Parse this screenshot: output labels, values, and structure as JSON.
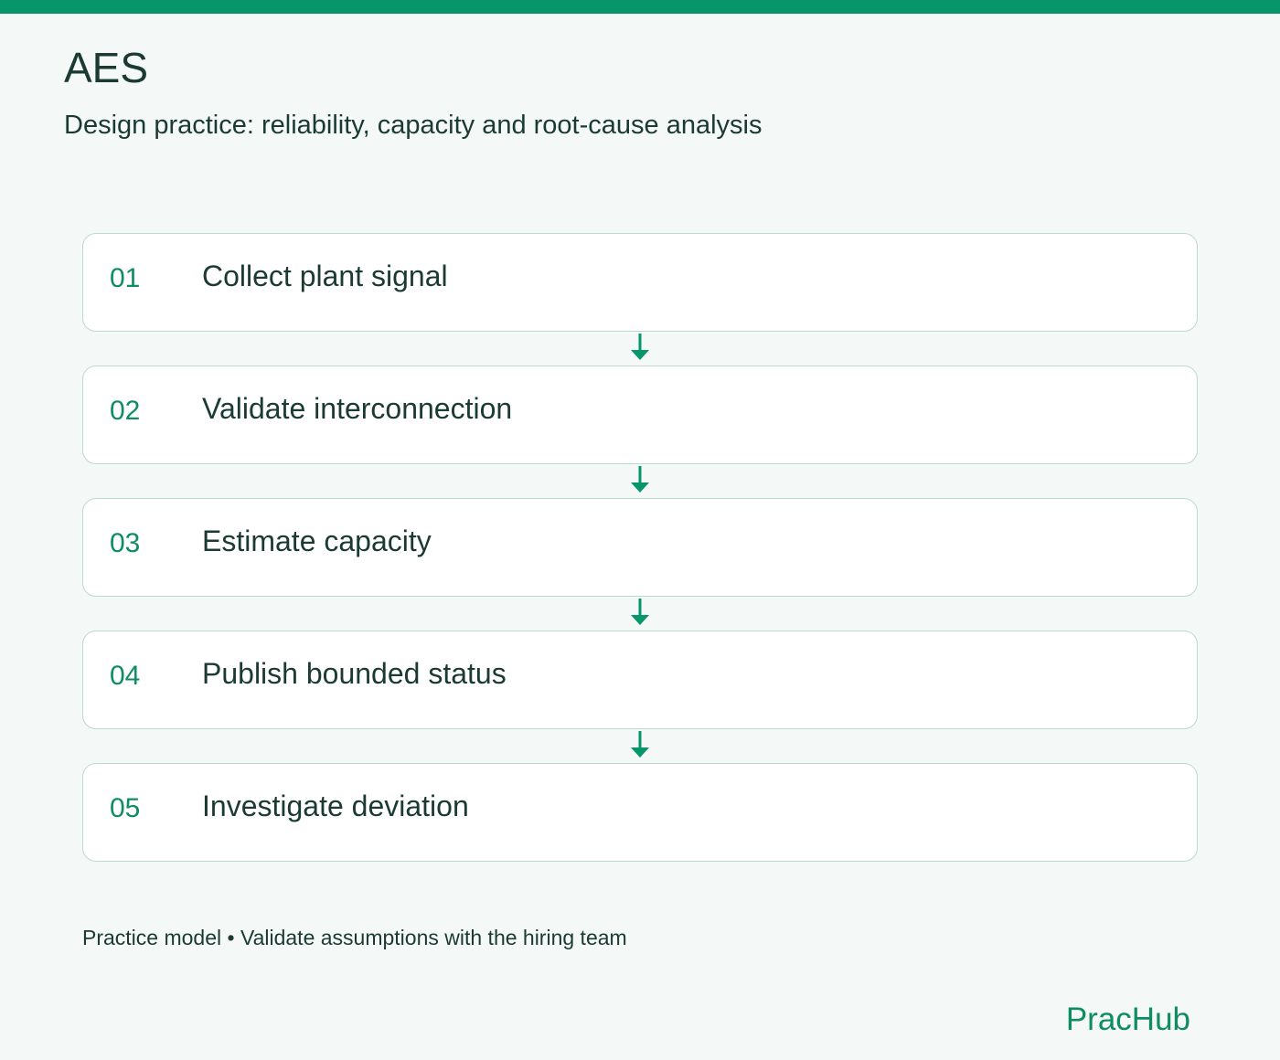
{
  "header": {
    "title": "AES",
    "subtitle": "Design practice: reliability, capacity and root-cause analysis"
  },
  "steps": [
    {
      "number": "01",
      "label": "Collect plant signal"
    },
    {
      "number": "02",
      "label": "Validate interconnection"
    },
    {
      "number": "03",
      "label": "Estimate capacity"
    },
    {
      "number": "04",
      "label": "Publish bounded status"
    },
    {
      "number": "05",
      "label": "Investigate deviation"
    }
  ],
  "footer": {
    "note": "Practice model • Validate assumptions with the hiring team",
    "brand": "PracHub"
  },
  "colors": {
    "accent": "#06966a",
    "text": "#1b3a33",
    "background": "#f4f8f6",
    "card_border": "#bcd9cf"
  },
  "icons": {
    "connector": "arrow-down-icon"
  }
}
